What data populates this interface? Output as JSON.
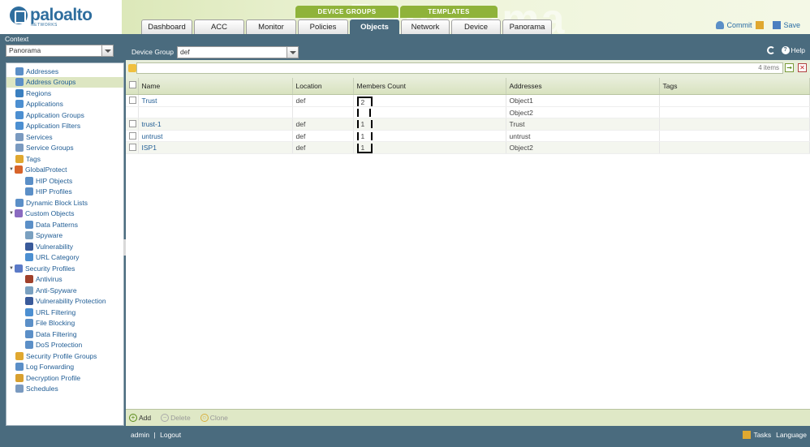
{
  "brand": {
    "name": "paloalto",
    "sub": "NETWORKS",
    "watermark": "Panorama"
  },
  "header": {
    "groups": {
      "device_groups": "DEVICE GROUPS",
      "templates": "TEMPLATES"
    },
    "tabs": [
      {
        "label": "Dashboard"
      },
      {
        "label": "ACC"
      },
      {
        "label": "Monitor"
      },
      {
        "label": "Policies"
      },
      {
        "label": "Objects"
      },
      {
        "label": "Network"
      },
      {
        "label": "Device"
      },
      {
        "label": "Panorama"
      }
    ],
    "active_tab": "Objects",
    "commit_label": "Commit",
    "save_label": "Save"
  },
  "context": {
    "label": "Context",
    "value": "Panorama"
  },
  "sidebar": {
    "items": [
      {
        "label": "Addresses",
        "color": "#5b8fc7"
      },
      {
        "label": "Address Groups",
        "color": "#5b8fc7",
        "selected": true
      },
      {
        "label": "Regions",
        "color": "#3a7fc0"
      },
      {
        "label": "Applications",
        "color": "#4c8fd1"
      },
      {
        "label": "Application Groups",
        "color": "#4c8fd1"
      },
      {
        "label": "Application Filters",
        "color": "#4c8fd1"
      },
      {
        "label": "Services",
        "color": "#7a9ac0"
      },
      {
        "label": "Service Groups",
        "color": "#7a9ac0"
      },
      {
        "label": "Tags",
        "color": "#e0a830"
      },
      {
        "label": "GlobalProtect",
        "color": "#d8642a",
        "tree": "▼"
      },
      {
        "label": "HIP Objects",
        "color": "#5b8fc7"
      },
      {
        "label": "HIP Profiles",
        "color": "#5b8fc7"
      },
      {
        "label": "Dynamic Block Lists",
        "color": "#5b8fc7"
      },
      {
        "label": "Custom Objects",
        "color": "#8a6ac0",
        "tree": "▼"
      },
      {
        "label": "Data Patterns",
        "color": "#5b8fc7"
      },
      {
        "label": "Spyware",
        "color": "#7aa0c0"
      },
      {
        "label": "Vulnerability",
        "color": "#3a5a9a"
      },
      {
        "label": "URL Category",
        "color": "#4c8fd1"
      },
      {
        "label": "Security Profiles",
        "color": "#5b7ac7",
        "tree": "▼"
      },
      {
        "label": "Antivirus",
        "color": "#a0402a"
      },
      {
        "label": "Anti-Spyware",
        "color": "#7aa0c0"
      },
      {
        "label": "Vulnerability Protection",
        "color": "#3a5a9a"
      },
      {
        "label": "URL Filtering",
        "color": "#4c8fd1"
      },
      {
        "label": "File Blocking",
        "color": "#5b8fc7"
      },
      {
        "label": "Data Filtering",
        "color": "#5b8fc7"
      },
      {
        "label": "DoS Protection",
        "color": "#5b8fc7"
      },
      {
        "label": "Security Profile Groups",
        "color": "#e0a830"
      },
      {
        "label": "Log Forwarding",
        "color": "#5b8fc7"
      },
      {
        "label": "Decryption Profile",
        "color": "#d8a030"
      },
      {
        "label": "Schedules",
        "color": "#7a9ac0"
      }
    ]
  },
  "main": {
    "device_group_label": "Device Group",
    "device_group_value": "def",
    "help_label": "Help",
    "item_count": "4 items",
    "columns": [
      "Name",
      "Location",
      "Members Count",
      "Addresses",
      "Tags"
    ],
    "rows": [
      {
        "name": "Trust",
        "location": "def",
        "members": "2",
        "addresses": [
          "Object1",
          "Object2"
        ],
        "tags": ""
      },
      {
        "name": "trust-1",
        "location": "def",
        "members": "1",
        "addresses": [
          "Trust"
        ],
        "tags": ""
      },
      {
        "name": "untrust",
        "location": "def",
        "members": "1",
        "addresses": [
          "untrust"
        ],
        "tags": ""
      },
      {
        "name": "ISP1",
        "location": "def",
        "members": "1",
        "addresses": [
          "Object2"
        ],
        "tags": ""
      }
    ]
  },
  "actions": {
    "add": "Add",
    "delete": "Delete",
    "clone": "Clone"
  },
  "status": {
    "user": "admin",
    "logout": "Logout",
    "tasks": "Tasks",
    "language": "Language"
  }
}
